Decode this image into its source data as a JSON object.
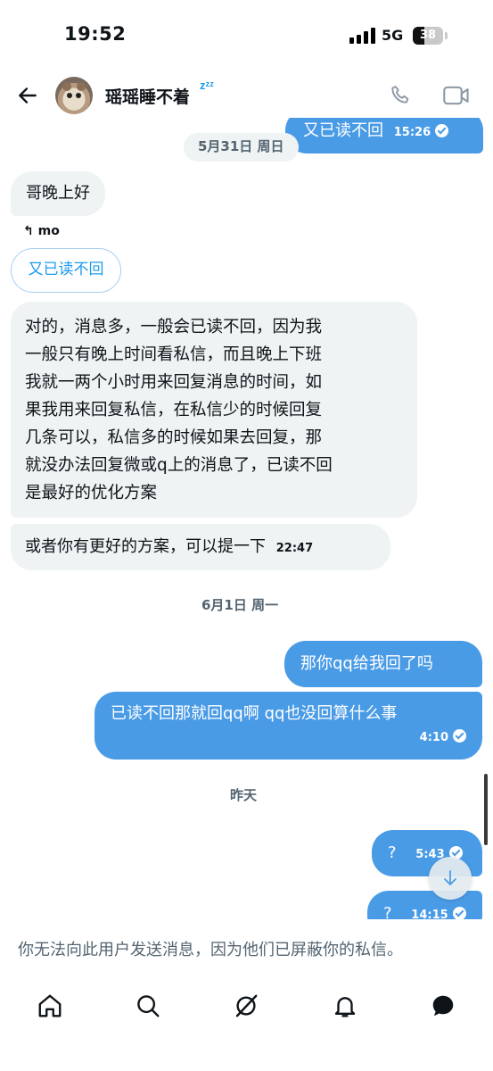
{
  "status_bar": {
    "time": "19:52",
    "network": "5G",
    "battery": "38",
    "battery_level": 0.38
  },
  "header": {
    "contact_name": "瑶瑶睡不着",
    "name_decoration": "zᶻᶻ"
  },
  "messages": {
    "out_top": {
      "text": "又已读不回",
      "time": "15:26"
    },
    "date1": "5月31日 周日",
    "in1": {
      "text": "哥晚上好"
    },
    "reply_label": "mo",
    "quoted": "又已读不回",
    "in2": {
      "lines": [
        "对的，消息多，一般会已读不回，因为我",
        "一般只有晚上时间看私信，而且晚上下班",
        "我就一两个小时用来回复消息的时间，如",
        "果我用来回复私信，在私信少的时候回复",
        "几条可以，私信多的时候如果去回复，那",
        "就没办法回复微或q上的消息了，已读不回",
        "是最好的优化方案"
      ]
    },
    "in3": {
      "text": "或者你有更好的方案，可以提一下",
      "time": "22:47"
    },
    "date2": "6月1日 周一",
    "out1": {
      "text": "那你qq给我回了吗"
    },
    "out2": {
      "text": "已读不回那就回qq啊 qq也没回算什么事",
      "time": "4:10"
    },
    "date3": "昨天",
    "out3": {
      "text": "?",
      "time": "5:43"
    },
    "out4": {
      "text": "?",
      "time": "14:15"
    }
  },
  "blocked_notice": "你无法向此用户发送消息，因为他们已屏蔽你的私信。",
  "nav": {
    "items": [
      "home-icon",
      "search-icon",
      "grok-icon",
      "notifications-icon",
      "messages-icon"
    ]
  },
  "colors": {
    "outgoing_bubble": "#4a9be6",
    "incoming_bubble": "#eff3f4",
    "accent": "#1d9bf0"
  }
}
